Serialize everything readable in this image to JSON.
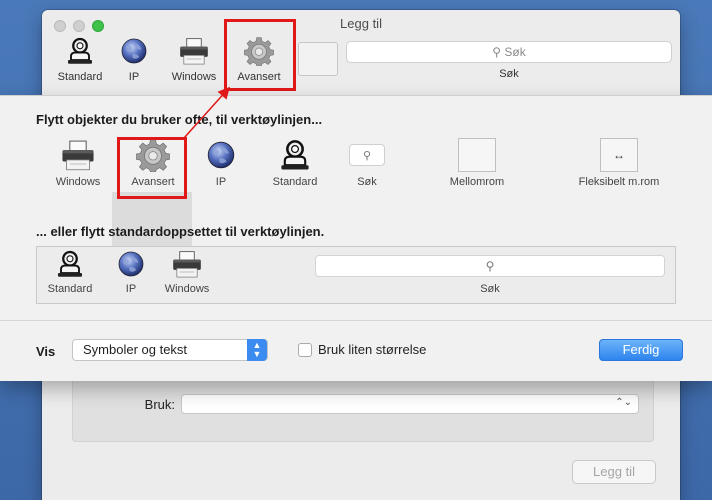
{
  "window": {
    "title": "Legg til",
    "toolbar": [
      {
        "label": "Standard",
        "icon": "standard-icon"
      },
      {
        "label": "IP",
        "icon": "globe-icon"
      },
      {
        "label": "Windows",
        "icon": "printer-icon"
      },
      {
        "label": "Avansert",
        "icon": "gear-icon"
      }
    ],
    "search_placeholder": "Søk",
    "search_label": "Søk"
  },
  "form": {
    "use_label": "Bruk:",
    "add_button": "Legg til"
  },
  "sheet": {
    "heading": "Flytt objekter du bruker ofte, til verktøylinjen...",
    "palette": [
      {
        "label": "Windows",
        "icon": "printer-icon"
      },
      {
        "label": "Avansert",
        "icon": "gear-icon"
      },
      {
        "label": "IP",
        "icon": "globe-icon"
      },
      {
        "label": "Standard",
        "icon": "standard-icon"
      },
      {
        "label": "Søk",
        "icon": "search-icon"
      },
      {
        "label": "Mellomrom",
        "icon": "space-icon"
      },
      {
        "label": "Fleksibelt m.rom",
        "icon": "flexible-space-icon"
      }
    ],
    "default_heading": "... eller flytt standardoppsettet til verktøylinjen.",
    "default_set": [
      {
        "label": "Standard",
        "icon": "standard-icon"
      },
      {
        "label": "IP",
        "icon": "globe-icon"
      },
      {
        "label": "Windows",
        "icon": "printer-icon"
      }
    ],
    "default_search_label": "Søk",
    "show_label": "Vis",
    "show_value": "Symboler og tekst",
    "small_size_label": "Bruk liten størrelse",
    "done_button": "Ferdig"
  },
  "colors": {
    "accent": "#2e84ee",
    "highlight": "#e01818",
    "desktop": "#4a79b9"
  }
}
